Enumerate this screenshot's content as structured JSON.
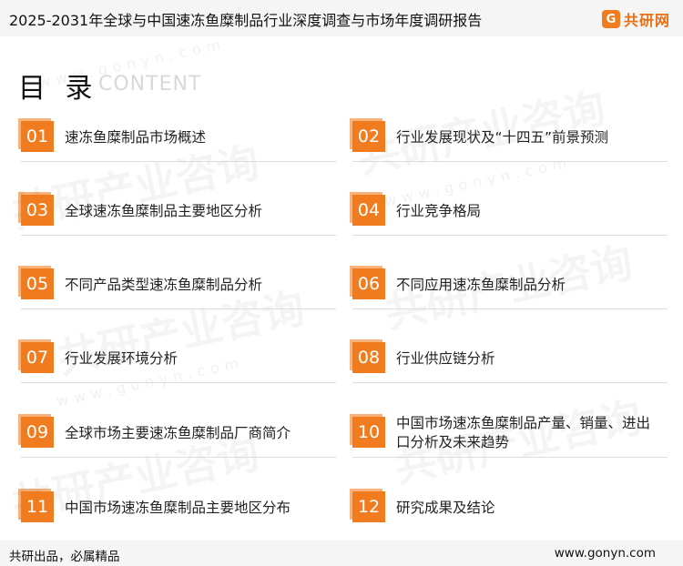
{
  "header": {
    "title": "2025-2031年全球与中国速冻鱼糜制品行业深度调查与市场年度调研报告",
    "brand_mark": "G",
    "brand_name": "共研网"
  },
  "watermark": {
    "text": "共研产业咨询",
    "url": "www.gonyn.com"
  },
  "toc": {
    "heading": "目 录",
    "subheading": "CONTENT",
    "items": [
      {
        "num": "01",
        "label": "速冻鱼糜制品市场概述"
      },
      {
        "num": "02",
        "label": "行业发展现状及“十四五”前景预测"
      },
      {
        "num": "03",
        "label": "全球速冻鱼糜制品主要地区分析"
      },
      {
        "num": "04",
        "label": "行业竞争格局"
      },
      {
        "num": "05",
        "label": "不同产品类型速冻鱼糜制品分析"
      },
      {
        "num": "06",
        "label": "不同应用速冻鱼糜制品分析"
      },
      {
        "num": "07",
        "label": "行业发展环境分析"
      },
      {
        "num": "08",
        "label": "行业供应链分析"
      },
      {
        "num": "09",
        "label": "全球市场主要速冻鱼糜制品厂商简介"
      },
      {
        "num": "10",
        "label": "中国市场速冻鱼糜制品产量、销量、进出口分析及未来趋势"
      },
      {
        "num": "11",
        "label": "中国市场速冻鱼糜制品主要地区分布"
      },
      {
        "num": "12",
        "label": "研究成果及结论"
      }
    ]
  },
  "footer": {
    "slogan": "共研出品，必属精品",
    "website": "www.gonyn.com"
  },
  "colors": {
    "accent": "#f07c1f",
    "accent_light": "#f9b27a"
  }
}
